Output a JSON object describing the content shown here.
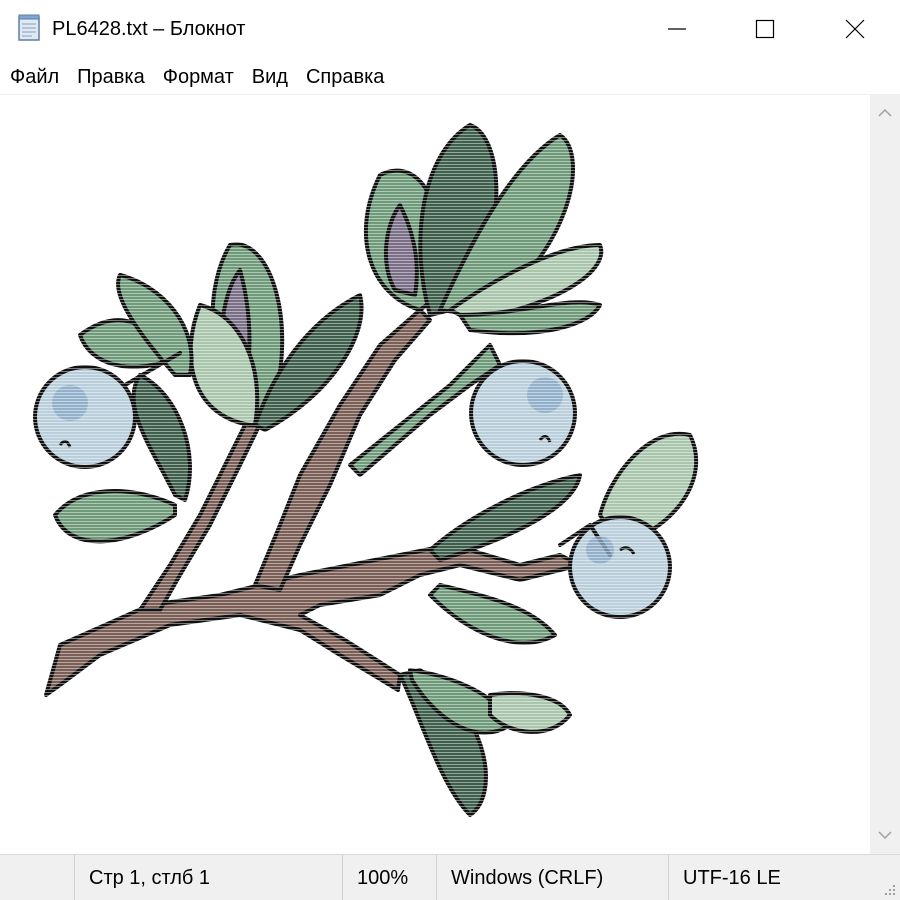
{
  "window": {
    "title": "PL6428.txt – Блокнот",
    "icon": "notepad-icon",
    "controls": [
      "minimize-icon",
      "maximize-icon",
      "close-icon"
    ]
  },
  "menu": {
    "items": [
      "Файл",
      "Правка",
      "Формат",
      "Вид",
      "Справка"
    ]
  },
  "document": {
    "content_kind": "ascii-art-image",
    "subject": "berry branch with leaves",
    "colors": {
      "leaf": "#6f9a7a",
      "leaf_dark": "#3e5f4b",
      "leaf_light": "#a9c6ad",
      "leaf_shadow": "#7a6d86",
      "stem": "#7b5f56",
      "berry": "#b9cedb",
      "berry_shade": "#8aa9c6",
      "outline": "#111111"
    }
  },
  "scrollbar": {
    "up": "chevron-up-icon",
    "down": "chevron-down-icon"
  },
  "status": {
    "position": "Стр 1, стлб 1",
    "zoom": "100%",
    "line_endings": "Windows (CRLF)",
    "encoding": "UTF-16 LE"
  }
}
